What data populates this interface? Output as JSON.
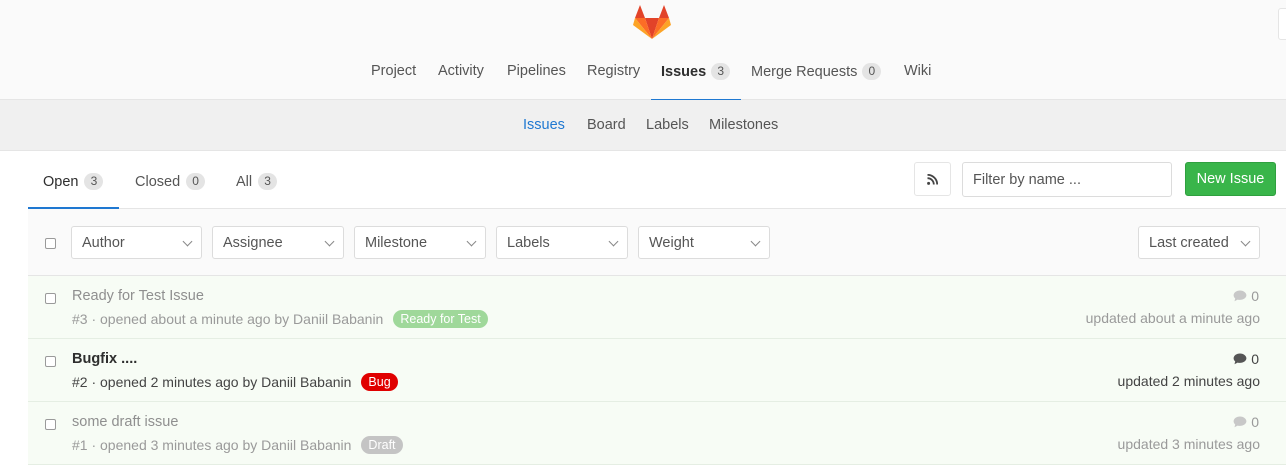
{
  "header": {
    "logo": "gitlab-tanuki-logo",
    "nav": [
      {
        "label": "Project"
      },
      {
        "label": "Activity"
      },
      {
        "label": "Pipelines"
      },
      {
        "label": "Registry"
      },
      {
        "label": "Issues",
        "count": "3",
        "active": true
      },
      {
        "label": "Merge Requests",
        "count": "0"
      },
      {
        "label": "Wiki"
      }
    ]
  },
  "subnav": [
    {
      "label": "Issues",
      "active": true
    },
    {
      "label": "Board"
    },
    {
      "label": "Labels"
    },
    {
      "label": "Milestones"
    }
  ],
  "state_tabs": [
    {
      "label": "Open",
      "count": "3",
      "active": true
    },
    {
      "label": "Closed",
      "count": "0"
    },
    {
      "label": "All",
      "count": "3"
    }
  ],
  "toolbar": {
    "rss_icon": "rss-icon",
    "filter_placeholder": "Filter by name ...",
    "new_issue_label": "New Issue"
  },
  "filters": {
    "dropdowns": [
      "Author",
      "Assignee",
      "Milestone",
      "Labels",
      "Weight"
    ],
    "sort": "Last created"
  },
  "issues": [
    {
      "title": "Ready for Test Issue",
      "meta": "#3 · opened about a minute ago by Daniil Babanin",
      "label": "Ready for Test",
      "label_color": "#9fd89a",
      "comments": "0",
      "updated": "updated about a minute ago"
    },
    {
      "title": "Bugfix ....",
      "meta": "#2 · opened 2 minutes ago by Daniil Babanin",
      "label": "Bug",
      "label_color": "#e00000",
      "comments": "0",
      "updated": "updated 2 minutes ago"
    },
    {
      "title": "some draft issue",
      "meta": "#1 · opened 3 minutes ago by Daniil Babanin",
      "label": "Draft",
      "label_color": "#c4c4c4",
      "comments": "0",
      "updated": "updated 3 minutes ago"
    }
  ],
  "colors": {
    "accent": "#1f78d1",
    "success": "#39b54a",
    "issue_row_bg": "#f7fcf5"
  }
}
